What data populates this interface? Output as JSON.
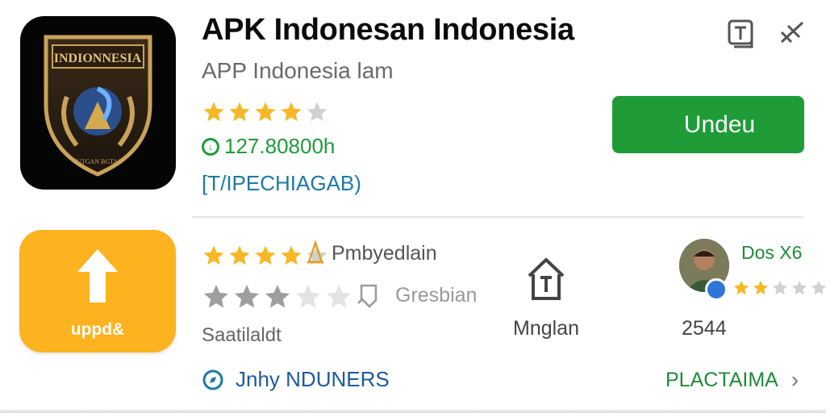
{
  "app": {
    "title": "APK Indonesan Indonesia",
    "subtitle": "APP Indonesia lam",
    "icon_text_top": "INDIONNESIA",
    "icon_text_bottom": "TUTGAN BGTAN",
    "rating_stars": 4,
    "downloads": "127.80800h",
    "category": "[T/IPECHIAGAB)"
  },
  "actions": {
    "install_label": "Undeu",
    "share_icon": "share-icon",
    "bookmark_icon": "bookmark-icon"
  },
  "update": {
    "label": "uppd&"
  },
  "details": {
    "rating1_stars": 4,
    "provider": "Pmbyedlain",
    "rating2_stars": 3,
    "free_label": "Gresbian",
    "small_label": "Saatilaldt",
    "home_label": "Mnglan",
    "developer": "Dos X6",
    "developer_stars": 2,
    "count": "2544"
  },
  "footer": {
    "left_label": "Jnhy NDUNERS",
    "right_label": "PLACTAIMA"
  },
  "colors": {
    "accent_green": "#1f9b37",
    "star_yellow": "#f6b827",
    "star_gray": "#d0d0d0",
    "update_orange": "#fcb31f",
    "link_blue": "#1c7aa6"
  }
}
